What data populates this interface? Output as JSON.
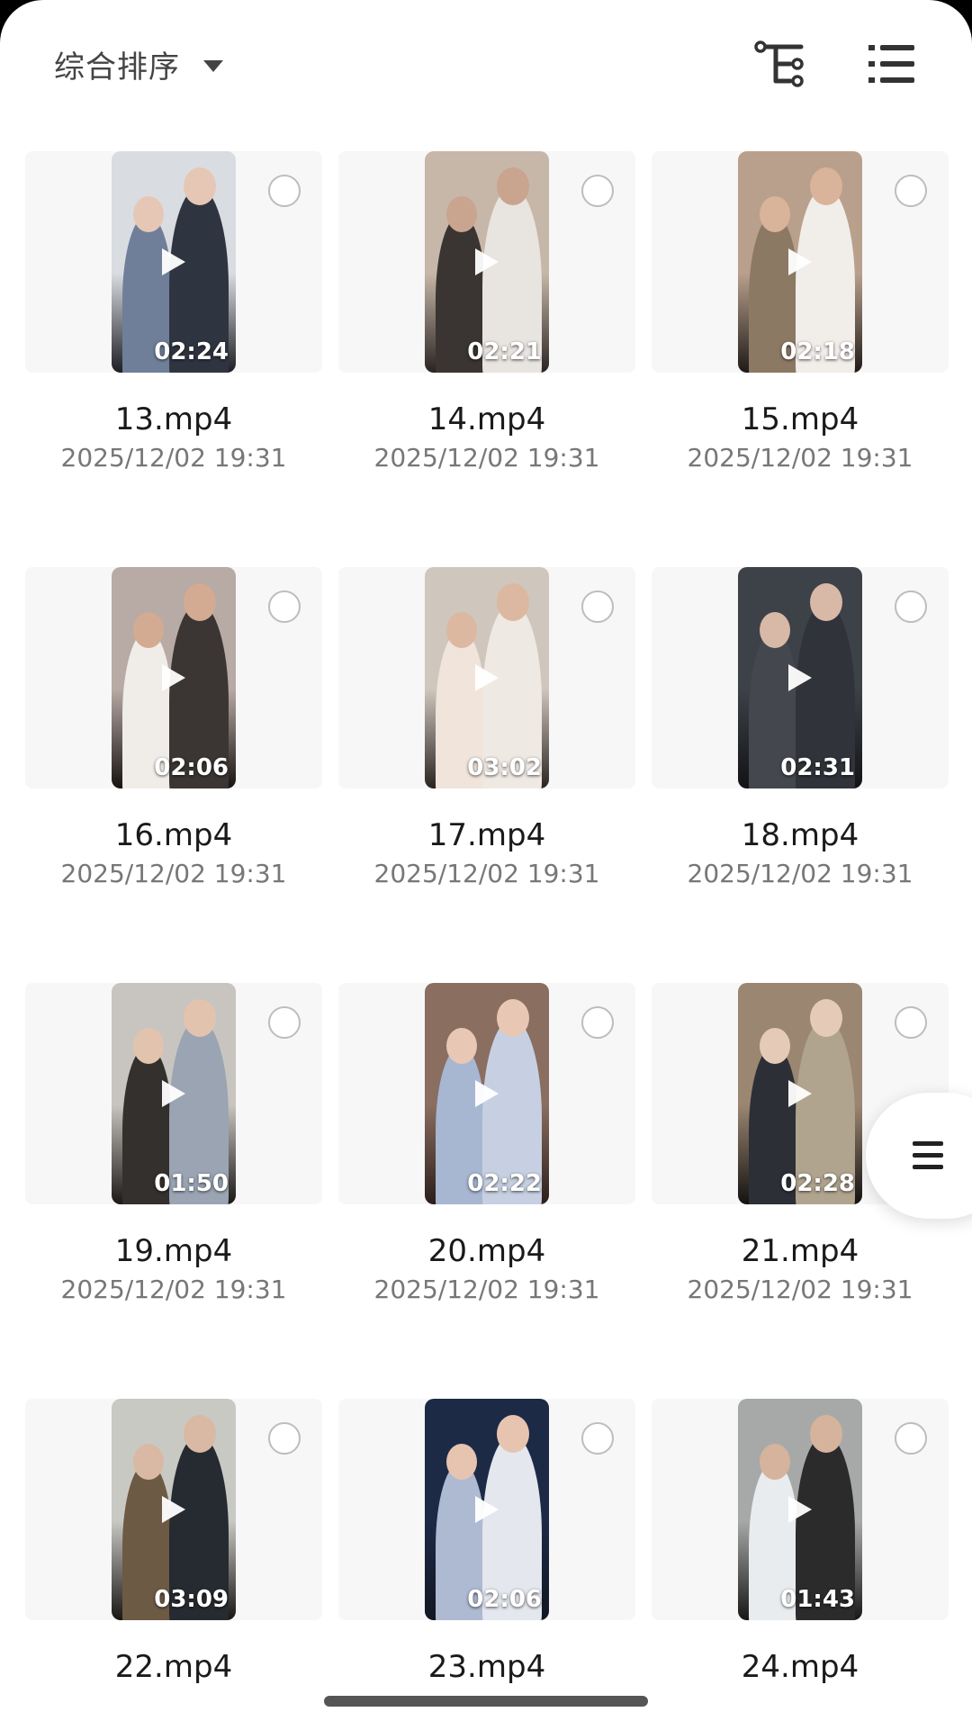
{
  "header": {
    "sort_label": "综合排序",
    "icons": [
      "tree-structure-icon",
      "list-view-icon"
    ]
  },
  "files": [
    {
      "name": "13.mp4",
      "date": "2025/12/02 19:31",
      "duration": "02:24"
    },
    {
      "name": "14.mp4",
      "date": "2025/12/02 19:31",
      "duration": "02:21"
    },
    {
      "name": "15.mp4",
      "date": "2025/12/02 19:31",
      "duration": "02:18"
    },
    {
      "name": "16.mp4",
      "date": "2025/12/02 19:31",
      "duration": "02:06"
    },
    {
      "name": "17.mp4",
      "date": "2025/12/02 19:31",
      "duration": "03:02"
    },
    {
      "name": "18.mp4",
      "date": "2025/12/02 19:31",
      "duration": "02:31"
    },
    {
      "name": "19.mp4",
      "date": "2025/12/02 19:31",
      "duration": "01:50"
    },
    {
      "name": "20.mp4",
      "date": "2025/12/02 19:31",
      "duration": "02:22"
    },
    {
      "name": "21.mp4",
      "date": "2025/12/02 19:31",
      "duration": "02:28"
    },
    {
      "name": "22.mp4",
      "date": "",
      "duration": "03:09"
    },
    {
      "name": "23.mp4",
      "date": "",
      "duration": "02:06"
    },
    {
      "name": "24.mp4",
      "date": "",
      "duration": "01:43"
    }
  ],
  "floating_button": {
    "icon": "menu-icon"
  },
  "colors": {
    "background": "#ffffff",
    "card": "#f7f7f8",
    "text": "#1a1a1a",
    "secondary_text": "#777777"
  }
}
